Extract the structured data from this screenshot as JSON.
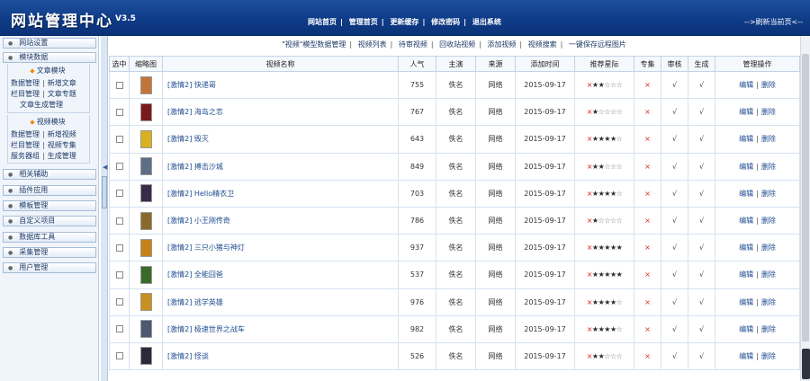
{
  "header": {
    "title": "网站管理中心",
    "version": "V3.5",
    "nav": [
      "网站首页",
      "管理首页",
      "更新缓存",
      "修改密码",
      "退出系统"
    ],
    "right_link": "-->刷新当前页<--"
  },
  "sidebar": {
    "items_top": [
      "网站设置",
      "模块数据"
    ],
    "text_module": {
      "heading": "文章模块",
      "rows": [
        [
          "数据管理",
          "新增文章"
        ],
        [
          "栏目管理",
          "文章专题"
        ],
        [
          "文章生成管理"
        ]
      ]
    },
    "video_module": {
      "heading": "视频模块",
      "rows": [
        [
          "数据管理",
          "新增视频"
        ],
        [
          "栏目管理",
          "视频专集"
        ],
        [
          "服务器组",
          "生成管理"
        ]
      ]
    },
    "items_bottom": [
      "相关辅助",
      "插件应用",
      "模板管理",
      "自定义项目",
      "数据库工具",
      "采集管理",
      "用户管理"
    ]
  },
  "subnav": {
    "title": "\"视频\"模型数据管理",
    "links": [
      "视频列表",
      "待审视频",
      "回收站视频",
      "添加视频",
      "视频搜索",
      "一键保存远程图片"
    ]
  },
  "table": {
    "headers": [
      "选中",
      "缩略图",
      "视频名称",
      "人气",
      "主演",
      "来源",
      "添加时间",
      "推荐星际",
      "专集",
      "审核",
      "生成",
      "管理操作"
    ],
    "rows": [
      {
        "name": "[激情2] 快递哥",
        "hits": "755",
        "actor": "佚名",
        "source": "网络",
        "date": "2015-09-17",
        "stars": 2,
        "zj": "×",
        "sh": "√",
        "sc": "√",
        "thumb": "#c4743a"
      },
      {
        "name": "[激情2] 海岛之恋",
        "hits": "767",
        "actor": "佚名",
        "source": "网络",
        "date": "2015-09-17",
        "stars": 1,
        "zj": "×",
        "sh": "√",
        "sc": "√",
        "thumb": "#7a1a1a"
      },
      {
        "name": "[激情2] 毁灭",
        "hits": "643",
        "actor": "佚名",
        "source": "网络",
        "date": "2015-09-17",
        "stars": 4,
        "zj": "×",
        "sh": "√",
        "sc": "√",
        "thumb": "#d8b020"
      },
      {
        "name": "[激情2] 搏击沙城",
        "hits": "849",
        "actor": "佚名",
        "source": "网络",
        "date": "2015-09-17",
        "stars": 2,
        "zj": "×",
        "sh": "√",
        "sc": "√",
        "thumb": "#5d6e86"
      },
      {
        "name": "[激情2] Hello精衣卫",
        "hits": "703",
        "actor": "佚名",
        "source": "网络",
        "date": "2015-09-17",
        "stars": 4,
        "zj": "×",
        "sh": "√",
        "sc": "√",
        "thumb": "#3a2a4a"
      },
      {
        "name": "[激情2] 小王刚传奇",
        "hits": "786",
        "actor": "佚名",
        "source": "网络",
        "date": "2015-09-17",
        "stars": 1,
        "zj": "×",
        "sh": "√",
        "sc": "√",
        "thumb": "#8a6a2a"
      },
      {
        "name": "[激情2] 三只小猪与神灯",
        "hits": "937",
        "actor": "佚名",
        "source": "网络",
        "date": "2015-09-17",
        "stars": 5,
        "zj": "×",
        "sh": "√",
        "sc": "√",
        "thumb": "#c8801a"
      },
      {
        "name": "[激情2] 全能囧爸",
        "hits": "537",
        "actor": "佚名",
        "source": "网络",
        "date": "2015-09-17",
        "stars": 5,
        "zj": "×",
        "sh": "√",
        "sc": "√",
        "thumb": "#3a6a2a"
      },
      {
        "name": "[激情2] 逃学英雄",
        "hits": "976",
        "actor": "佚名",
        "source": "网络",
        "date": "2015-09-17",
        "stars": 4,
        "zj": "×",
        "sh": "√",
        "sc": "√",
        "thumb": "#c89020"
      },
      {
        "name": "[激情2] 极速世界之战车",
        "hits": "982",
        "actor": "佚名",
        "source": "网络",
        "date": "2015-09-17",
        "stars": 4,
        "zj": "×",
        "sh": "√",
        "sc": "√",
        "thumb": "#4a5870"
      },
      {
        "name": "[激情2] 怪谈",
        "hits": "526",
        "actor": "佚名",
        "source": "网络",
        "date": "2015-09-17",
        "stars": 2,
        "zj": "×",
        "sh": "√",
        "sc": "√",
        "thumb": "#2a2a3a"
      }
    ],
    "op_edit": "编辑",
    "op_delete": "删除"
  },
  "colors": {
    "header_bg": "#0e3a85",
    "link": "#1d4b8f",
    "no_mark": "#dd2222"
  }
}
